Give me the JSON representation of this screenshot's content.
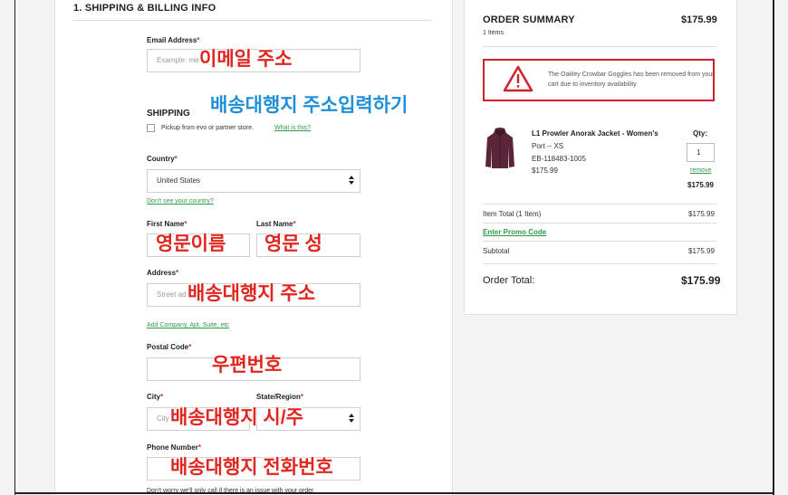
{
  "form": {
    "section_title": "1. SHIPPING & BILLING INFO",
    "email_label": "Email Address",
    "email_placeholder": "Example: me",
    "shipping_heading": "SHIPPING",
    "pickup_label": "Pickup from evo or partner store.",
    "pickup_link": "What is this?",
    "country_label": "Country",
    "country_value": "United States",
    "country_link": "Don't see your country?",
    "first_name_label": "First Name",
    "last_name_label": "Last Name",
    "address_label": "Address",
    "address_placeholder": "Street ad",
    "address_link": "Add Company, Apt, Suite, etc",
    "postal_label": "Postal Code",
    "city_label": "City",
    "city_placeholder": "City",
    "state_label": "State/Region",
    "state_value": "Sele         n",
    "phone_label": "Phone Number",
    "phone_note": "Don't worry we'll only call if there is an issue with your order.",
    "required_mark": "*"
  },
  "annotations": {
    "email": "이메일 주소",
    "shipping_address_input": "배송대행지 주소입력하기",
    "first_name": "영문이름",
    "last_name": "영문 성",
    "address": "배송대행지 주소",
    "postal": "우편번호",
    "city_state": "배송대행지 시/주",
    "phone": "배송대행지 전화번호"
  },
  "summary": {
    "title": "ORDER SUMMARY",
    "total_top": "$175.99",
    "items_count": "1 Items",
    "alert_text": "The Oakley Crowbar Goggles has been removed from your cart due to inventory availability",
    "product_name": "L1 Prowler Anorak Jacket - Women's",
    "product_variant": "Port -- XS",
    "product_sku": "EB-118483-1005",
    "product_price": "$175.99",
    "qty_label": "Qty:",
    "qty_value": "1",
    "remove_label": "remove",
    "line_price": "$175.99",
    "item_total_label": "Item Total (1 Item)",
    "item_total_value": "$175.99",
    "promo_link": "Enter Promo Code",
    "subtotal_label": "Subtotal",
    "subtotal_value": "$175.99",
    "order_total_label": "Order Total:",
    "order_total_value": "$175.99"
  },
  "colors": {
    "accent_link": "#2e9b4a",
    "alert_red": "#d0202a",
    "annotation_red": "#e0261e",
    "annotation_blue": "#1e8fd6"
  },
  "icons": {
    "alert": "warning-triangle-icon",
    "select": "select-arrows-icon"
  }
}
